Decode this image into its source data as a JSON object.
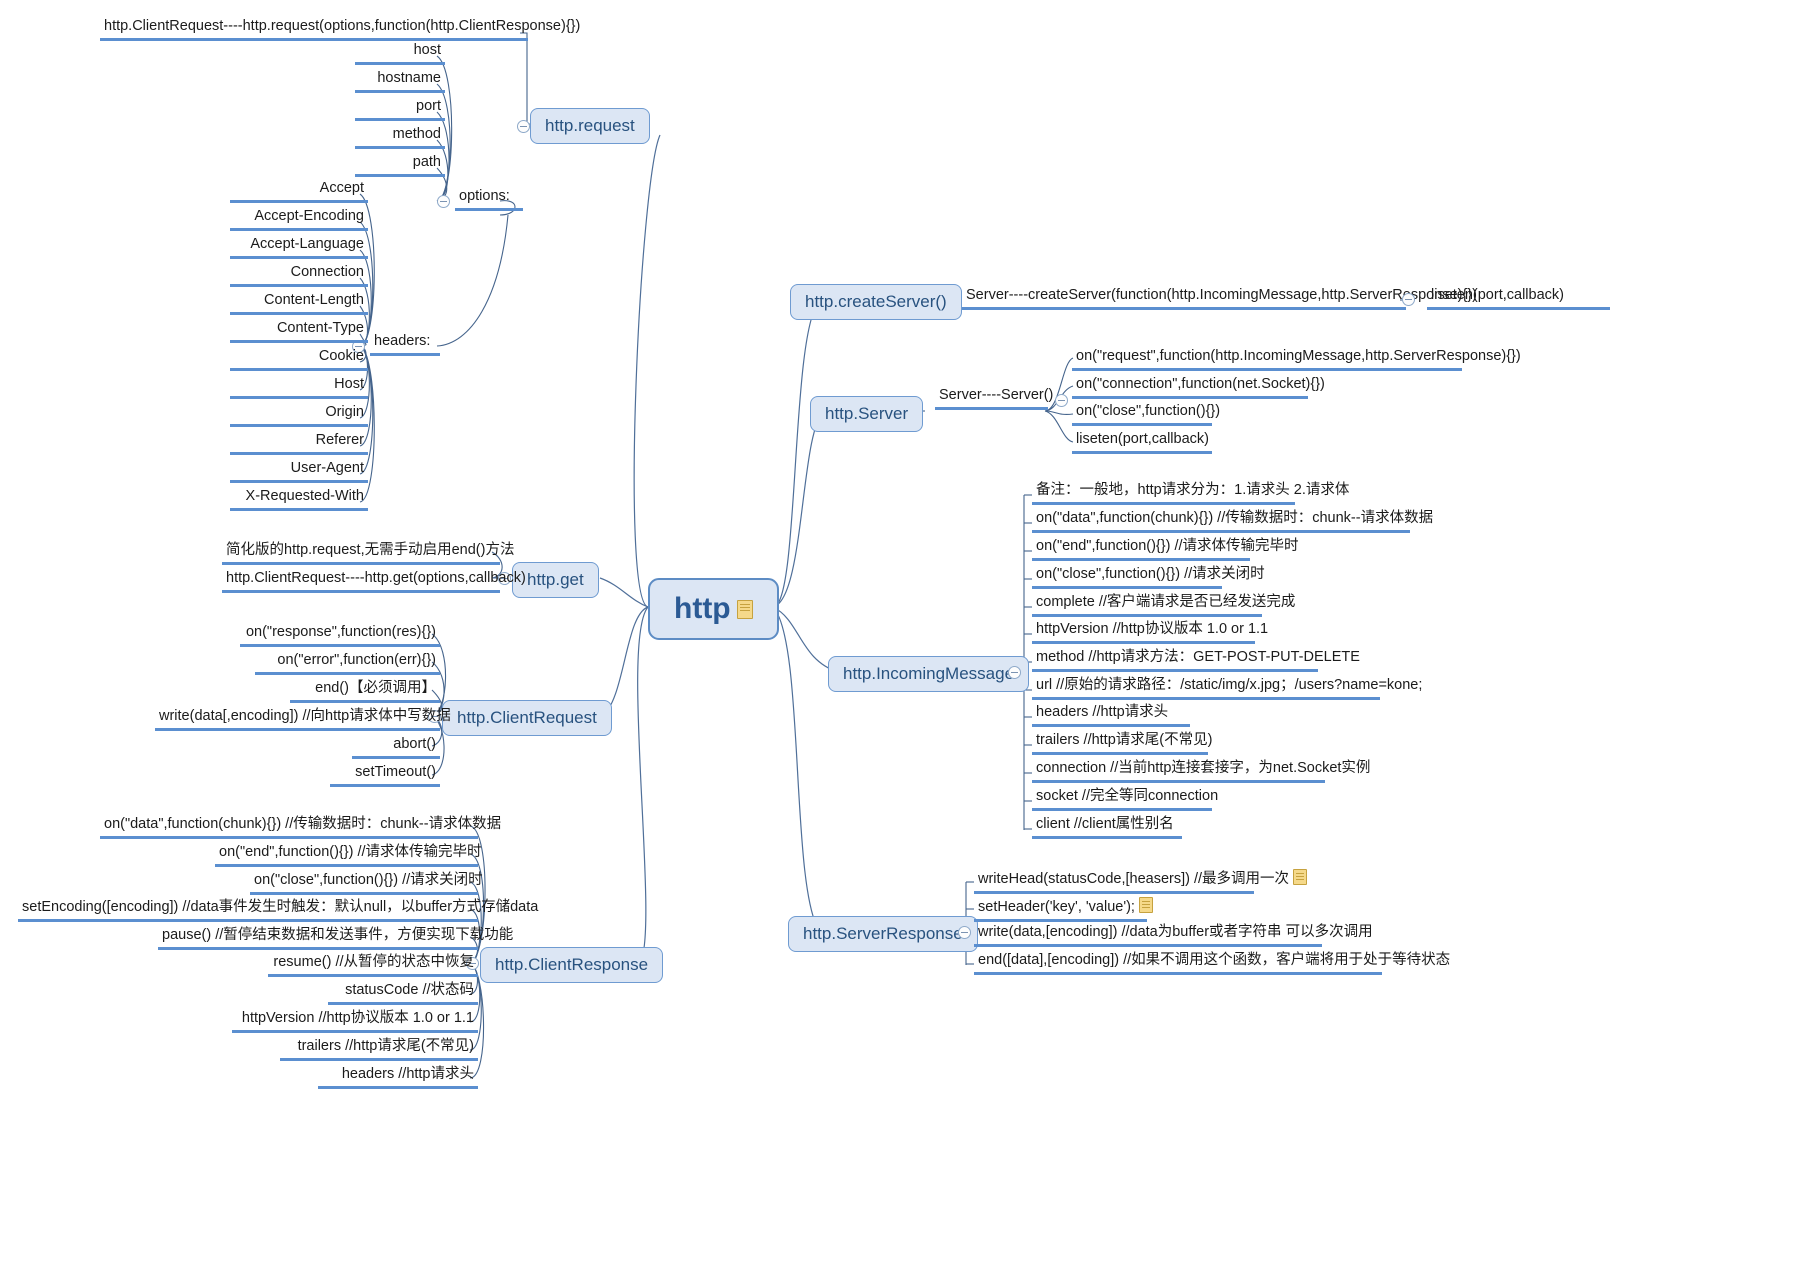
{
  "root": {
    "label": "http",
    "icon": "note-icon"
  },
  "request": {
    "topic": "http.request",
    "signature": "http.ClientRequest----http.request(options,function(http.ClientResponse){})",
    "options_label": "options:",
    "options": [
      "host",
      "hostname",
      "port",
      "method",
      "path"
    ],
    "headers_label": "headers:",
    "headers": [
      "Accept",
      "Accept-Encoding",
      "Accept-Language",
      "Connection",
      "Content-Length",
      "Content-Type",
      "Cookie",
      "Host",
      "Origin",
      "Referer",
      "User-Agent",
      "X-Requested-With"
    ]
  },
  "get": {
    "topic": "http.get",
    "notes": [
      "简化版的http.request,无需手动启用end()方法",
      "http.ClientRequest----http.get(options,callback)"
    ]
  },
  "clientRequest": {
    "topic": "http.ClientRequest",
    "items": [
      "on(\"response\",function(res){})",
      "on(\"error\",function(err){})",
      "end()【必须调用】",
      "write(data[,encoding])  //向http请求体中写数据",
      "abort()",
      "setTimeout()"
    ]
  },
  "clientResponse": {
    "topic": "http.ClientResponse",
    "items": [
      "on(\"data\",function(chunk){})  //传输数据时：chunk--请求体数据",
      "on(\"end\",function(){})  //请求体传输完毕时",
      "on(\"close\",function(){}) //请求关闭时",
      "setEncoding([encoding])  //data事件发生时触发：默认null，以buffer方式存储data",
      "pause()  //暂停结束数据和发送事件，方便实现下载功能",
      "resume()  //从暂停的状态中恢复",
      "statusCode //状态码",
      "httpVersion  //http协议版本 1.0 or 1.1",
      "trailers  //http请求尾(不常见)",
      "headers  //http请求头"
    ]
  },
  "createServer": {
    "topic": "http.createServer()",
    "signature": "Server----createServer(function(http.IncomingMessage,http.ServerResponse){})",
    "child": "liseten(port,callback)"
  },
  "server": {
    "topic": "http.Server",
    "signature": "Server----Server()",
    "items": [
      "on(\"request\",function(http.IncomingMessage,http.ServerResponse){})",
      "on(\"connection\",function(net.Socket){})",
      "on(\"close\",function(){})",
      "liseten(port,callback)"
    ]
  },
  "incomingMessage": {
    "topic": "http.IncomingMessage",
    "items": [
      "备注：一般地，http请求分为：1.请求头 2.请求体",
      "on(\"data\",function(chunk){})  //传输数据时：chunk--请求体数据",
      "on(\"end\",function(){})  //请求体传输完毕时",
      "on(\"close\",function(){}) //请求关闭时",
      "complete  //客户端请求是否已经发送完成",
      "httpVersion  //http协议版本 1.0 or 1.1",
      "method  //http请求方法：GET-POST-PUT-DELETE",
      "url  //原始的请求路径：/static/img/x.jpg；/users?name=kone;",
      "headers  //http请求头",
      "trailers  //http请求尾(不常见)",
      "connection  //当前http连接套接字，为net.Socket实例",
      "socket  //完全等同connection",
      "client  //client属性别名"
    ]
  },
  "serverResponse": {
    "topic": "http.ServerResponse",
    "items": [
      {
        "text": "writeHead(statusCode,[heasers])  //最多调用一次",
        "icon": "note-icon"
      },
      {
        "text": "setHeader('key', 'value');",
        "icon": "note-icon"
      },
      {
        "text": "write(data,[encoding])  //data为buffer或者字符串 可以多次调用",
        "icon": null
      },
      {
        "text": "end([data],[encoding])  //如果不调用这个函数，客户端将用于处于等待状态",
        "icon": null
      }
    ]
  },
  "colors": {
    "line": "#5b8fd0",
    "curve": "#45648c",
    "topic_fill": "#dce6f4",
    "topic_border": "#6f9bd1",
    "topic_text": "#28527f",
    "text": "#1b1b1b"
  }
}
